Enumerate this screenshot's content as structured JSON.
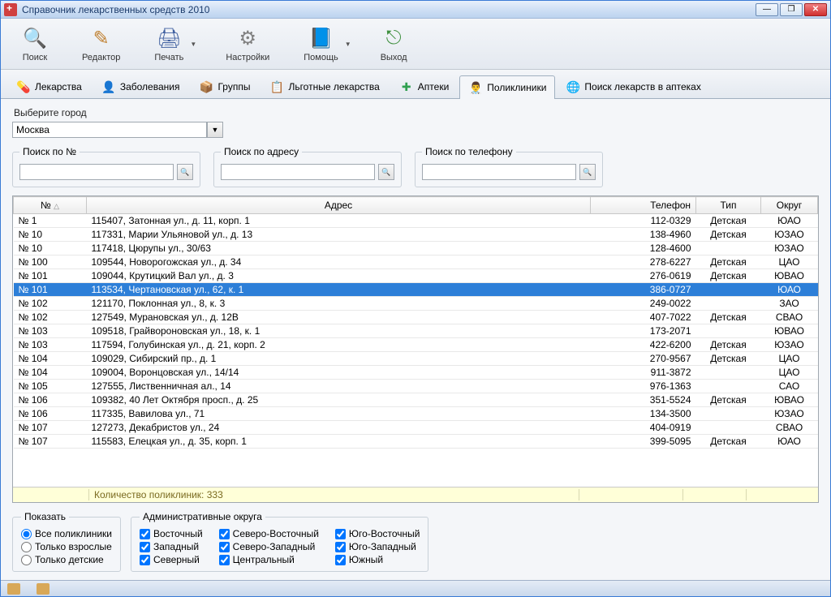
{
  "window": {
    "title": "Справочник лекарственных средств 2010"
  },
  "toolbar": {
    "search": "Поиск",
    "editor": "Редактор",
    "print": "Печать",
    "settings": "Настройки",
    "help": "Помощь",
    "exit": "Выход"
  },
  "tabs": {
    "meds": "Лекарства",
    "diseases": "Заболевания",
    "groups": "Группы",
    "lgot": "Льготные лекарства",
    "pharmacies": "Аптеки",
    "clinics": "Поликлиники",
    "find_in_pharm": "Поиск лекарств в аптеках"
  },
  "city": {
    "label": "Выберите город",
    "value": "Москва"
  },
  "search": {
    "by_num": "Поиск по №",
    "by_addr": "Поиск по адресу",
    "by_tel": "Поиск по телефону"
  },
  "table": {
    "headers": {
      "num": "№",
      "addr": "Адрес",
      "tel": "Телефон",
      "type": "Тип",
      "okr": "Округ"
    },
    "footer": "Количество поликлиник: 333",
    "rows": [
      {
        "num": "№ 1",
        "addr": "115407, Затонная ул., д. 11, корп. 1",
        "tel": "112-0329",
        "type": "Детская",
        "okr": "ЮАО"
      },
      {
        "num": "№ 10",
        "addr": "117331, Марии Ульяновой ул., д. 13",
        "tel": "138-4960",
        "type": "Детская",
        "okr": "ЮЗАО"
      },
      {
        "num": "№ 10",
        "addr": "117418, Цюрупы ул., 30/63",
        "tel": "128-4600",
        "type": "",
        "okr": "ЮЗАО"
      },
      {
        "num": "№ 100",
        "addr": "109544, Новорогожская ул., д. 34",
        "tel": "278-6227",
        "type": "Детская",
        "okr": "ЦАО"
      },
      {
        "num": "№ 101",
        "addr": "109044, Крутицкий Вал ул., д. 3",
        "tel": "276-0619",
        "type": "Детская",
        "okr": "ЮВАО"
      },
      {
        "num": "№ 101",
        "addr": "113534, Чертановская ул., 62, к. 1",
        "tel": "386-0727",
        "type": "",
        "okr": "ЮАО",
        "selected": true
      },
      {
        "num": "№ 102",
        "addr": "121170, Поклонная ул., 8, к. 3",
        "tel": "249-0022",
        "type": "",
        "okr": "ЗАО"
      },
      {
        "num": "№ 102",
        "addr": "127549, Мурановская ул., д. 12В",
        "tel": "407-7022",
        "type": "Детская",
        "okr": "СВАО"
      },
      {
        "num": "№ 103",
        "addr": "109518, Грайвороновская ул., 18, к. 1",
        "tel": "173-2071",
        "type": "",
        "okr": "ЮВАО"
      },
      {
        "num": "№ 103",
        "addr": "117594, Голубинская ул., д. 21, корп. 2",
        "tel": "422-6200",
        "type": "Детская",
        "okr": "ЮЗАО"
      },
      {
        "num": "№ 104",
        "addr": "109029, Сибирский пр., д. 1",
        "tel": "270-9567",
        "type": "Детская",
        "okr": "ЦАО"
      },
      {
        "num": "№ 104",
        "addr": "109004, Воронцовская ул., 14/14",
        "tel": "911-3872",
        "type": "",
        "okr": "ЦАО"
      },
      {
        "num": "№ 105",
        "addr": "127555, Лиственничная ал., 14",
        "tel": "976-1363",
        "type": "",
        "okr": "САО"
      },
      {
        "num": "№ 106",
        "addr": "109382, 40 Лет Октября просп., д. 25",
        "tel": "351-5524",
        "type": "Детская",
        "okr": "ЮВАО"
      },
      {
        "num": "№ 106",
        "addr": "117335, Вавилова ул., 71",
        "tel": "134-3500",
        "type": "",
        "okr": "ЮЗАО"
      },
      {
        "num": "№ 107",
        "addr": "127273, Декабристов ул., 24",
        "tel": "404-0919",
        "type": "",
        "okr": "СВАО"
      },
      {
        "num": "№ 107",
        "addr": "115583, Елецкая ул., д. 35, корп. 1",
        "tel": "399-5095",
        "type": "Детская",
        "okr": "ЮАО"
      }
    ]
  },
  "filters": {
    "show_label": "Показать",
    "all": "Все поликлиники",
    "adults": "Только взрослые",
    "children": "Только детские",
    "districts_label": "Административные округа",
    "d": {
      "east": "Восточный",
      "west": "Западный",
      "north": "Северный",
      "ne": "Северо-Восточный",
      "nw": "Северо-Западный",
      "central": "Центральный",
      "se": "Юго-Восточный",
      "sw": "Юго-Западный",
      "south": "Южный"
    }
  }
}
